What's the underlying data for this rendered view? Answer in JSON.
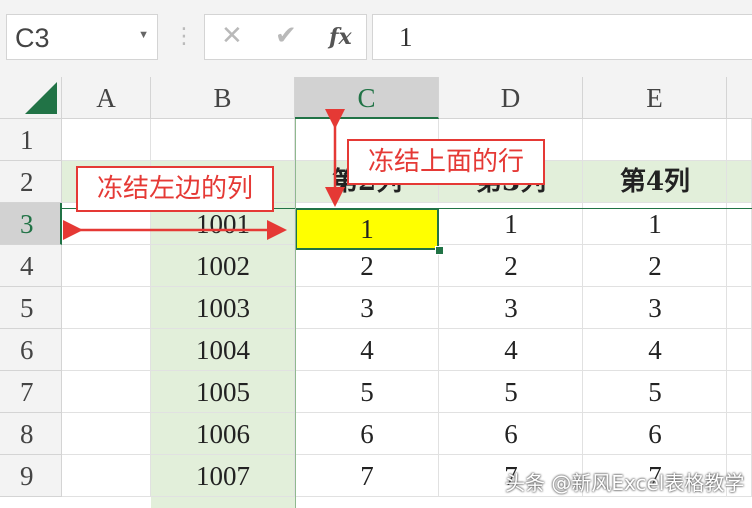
{
  "namebox": {
    "value": "C3"
  },
  "formula_bar": {
    "cancel_icon": "✕",
    "enter_icon": "✔",
    "fx_label": "fx",
    "value": "1"
  },
  "columns": [
    "A",
    "B",
    "C",
    "D",
    "E"
  ],
  "rows": [
    "1",
    "2",
    "3",
    "4",
    "5",
    "6",
    "7",
    "8",
    "9"
  ],
  "header_row": {
    "c": "第2列",
    "d": "第3列",
    "e": "第4列"
  },
  "b_values": [
    "1001",
    "1002",
    "1003",
    "1004",
    "1005",
    "1006",
    "1007"
  ],
  "c_values": [
    "1",
    "2",
    "3",
    "4",
    "5",
    "6",
    "7"
  ],
  "d_values": [
    "1",
    "2",
    "3",
    "4",
    "5",
    "6",
    "7"
  ],
  "e_values": [
    "1",
    "2",
    "3",
    "4",
    "5",
    "6",
    "7"
  ],
  "callouts": {
    "freeze_left": "冻结左边的列",
    "freeze_top": "冻结上面的行"
  },
  "watermark": "头条 @新风Excel表格教学",
  "colors": {
    "freeze_fill": "#e2efda",
    "selection_fill": "#ffff00",
    "accent": "#217346",
    "callout": "#e53935"
  }
}
